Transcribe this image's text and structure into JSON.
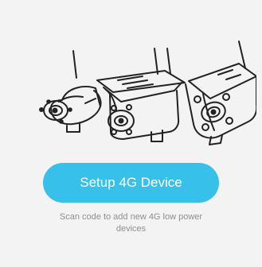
{
  "screen": {
    "illustration_alt": "4G camera devices"
  },
  "actions": {
    "setup_label": "Setup 4G Device"
  },
  "hint": {
    "text": "Scan code to add new 4G low power devices"
  },
  "colors": {
    "background": "#f3f3f3",
    "accent": "#36c0ea",
    "hint_text": "#8f8f8f"
  },
  "icons": {
    "illustration": "camera-icons"
  }
}
